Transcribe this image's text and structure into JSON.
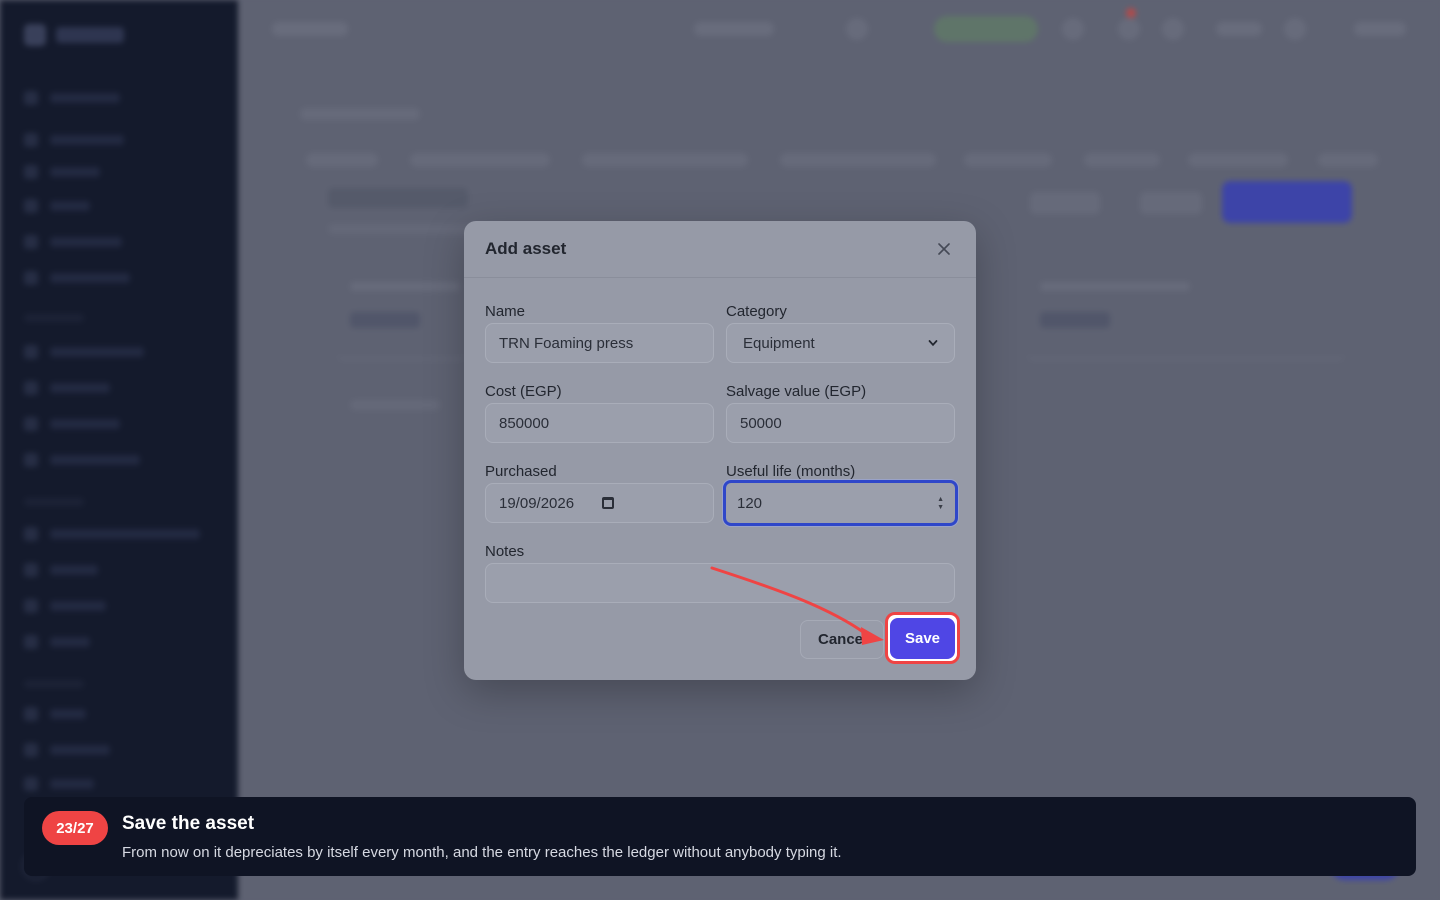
{
  "modal": {
    "title": "Add asset",
    "close_icon": "close-icon",
    "fields": {
      "name": {
        "label": "Name",
        "value": "TRN Foaming press"
      },
      "category": {
        "label": "Category",
        "value": "Equipment"
      },
      "cost": {
        "label": "Cost (EGP)",
        "value": "850000"
      },
      "salvage": {
        "label": "Salvage value (EGP)",
        "value": "50000"
      },
      "purchased": {
        "label": "Purchased",
        "value": "19/09/2026"
      },
      "useful_life": {
        "label": "Useful life (months)",
        "value": "120"
      },
      "notes": {
        "label": "Notes",
        "value": ""
      }
    },
    "cancel_label": "Cancel",
    "save_label": "Save"
  },
  "tour": {
    "step": "23/27",
    "title": "Save the asset",
    "body": "From now on it depreciates by itself every month, and the entry reaches the ledger without anybody typing it."
  },
  "colors": {
    "primary": "#4f46e5",
    "highlight": "#ef4444",
    "focus": "#2f47c9",
    "tour_bg": "#0f1424"
  }
}
